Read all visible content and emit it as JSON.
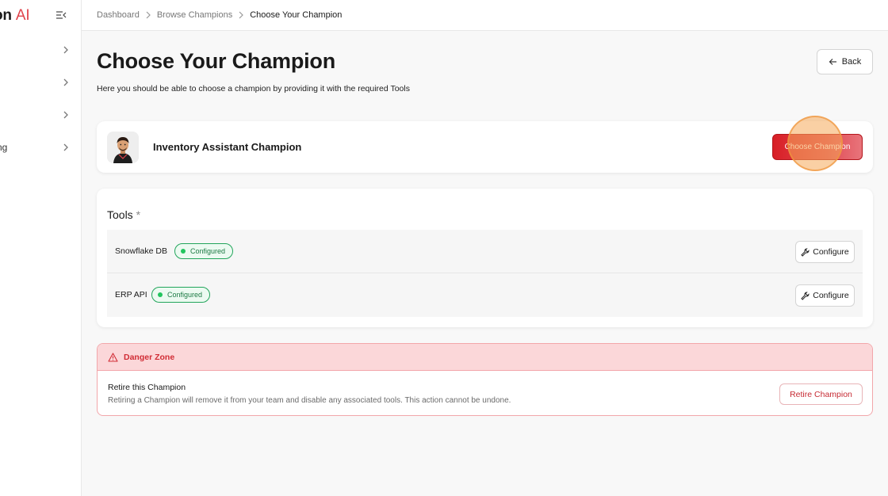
{
  "sidebar": {
    "logo_text": "on",
    "logo_accent": "AI",
    "items": [
      {
        "label": ""
      },
      {
        "label": ""
      },
      {
        "label": ""
      },
      {
        "label": "ng"
      }
    ]
  },
  "breadcrumb": {
    "items": [
      "Dashboard",
      "Browse Champions",
      "Choose Your Champion"
    ]
  },
  "page": {
    "title": "Choose Your Champion",
    "subtitle": "Here you should be able to choose a champion by providing it with the required Tools",
    "back_label": "Back"
  },
  "champion": {
    "name": "Inventory Assistant Champion",
    "choose_label": "Choose Champion"
  },
  "tools": {
    "title": "Tools",
    "required_mark": "*",
    "items": [
      {
        "name": "Snowflake DB",
        "status": "Configured",
        "action": "Configure"
      },
      {
        "name": "ERP API",
        "status": "Configured",
        "action": "Configure"
      }
    ]
  },
  "danger": {
    "title": "Danger Zone",
    "retire_title": "Retire this Champion",
    "retire_desc": "Retiring a Champion will remove it from your team and disable any associated tools. This action cannot be undone.",
    "retire_label": "Retire Champion"
  },
  "colors": {
    "brand_red": "#d81f26",
    "success_green": "#22c55e",
    "danger_bg": "#fbd7d9"
  }
}
